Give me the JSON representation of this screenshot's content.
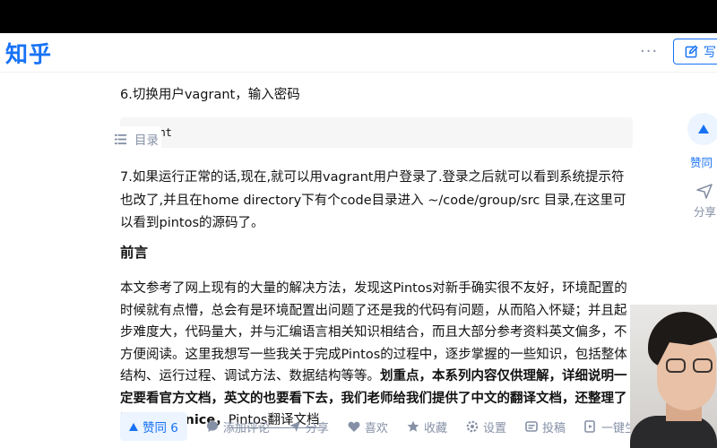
{
  "header": {
    "logo": "知乎",
    "more_icon": "···",
    "write_label": "写"
  },
  "toc": {
    "label": "目录"
  },
  "article": {
    "step6": "6.切换用户vagrant，输入密码",
    "code": "vagrant",
    "code_visible": "rant",
    "step7": "7.如果运行正常的话,现在,就可以用vagrant用户登录了.登录之后就可以看到系统提示符也改了,并且在home directory下有个code目录进入 ~/code/group/src 目录,在这里可以看到pintos的源码了。",
    "preface_heading": "前言",
    "preface_plain": "本文参考了网上现有的大量的解决方法，发现这Pintos对新手确实很不友好，环境配置的时候就有点懵，总会有是环境配置出问题了还是我的代码有问题，从而陷入怀疑；并且起步难度大，代码量大，并与汇编语言相关知识相结合，而且大部分参考资料英文偏多，不方便阅读。这里我想写一些我关于完成Pintos的过程中，逐步掌握的一些知识，包括整体结构、运行过程、调试方法、数据结构等等。",
    "preface_bold": "划重点，本系列内容仅供理解，详细说明一定要看官方文档，英文的也要看下去，我们老师给我们提供了中文的翻译文档，还整理了顺序，非常nice，",
    "preface_link": "Pintos翻译文档"
  },
  "side": {
    "vote_label": "赞同 6",
    "share_label": "分享"
  },
  "actions": {
    "vote": "赞同 6",
    "comment": "添加评论",
    "share": "分享",
    "like": "喜欢",
    "favorite": "收藏",
    "settings": "设置",
    "post": "投稿",
    "generate_video": "一键生成视频"
  },
  "colors": {
    "brand": "#1772f6",
    "muted": "#8590a6",
    "text": "#121212",
    "vote_bg": "#ebf4ff"
  }
}
